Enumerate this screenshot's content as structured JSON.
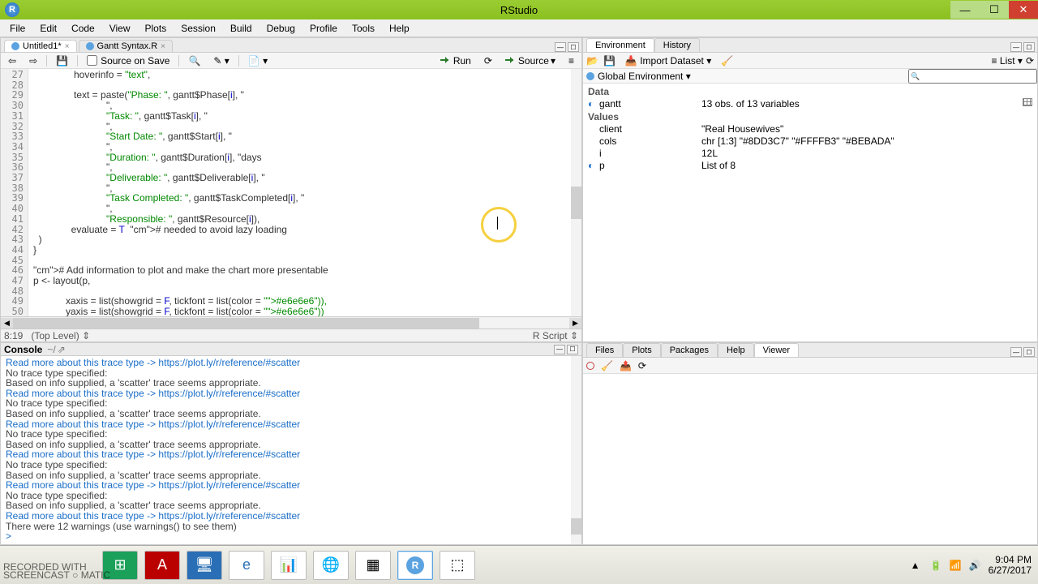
{
  "window": {
    "title": "RStudio"
  },
  "menu": [
    "File",
    "Edit",
    "Code",
    "View",
    "Plots",
    "Session",
    "Build",
    "Debug",
    "Profile",
    "Tools",
    "Help"
  ],
  "editor": {
    "tabs": [
      {
        "label": "Untitled1*",
        "active": true
      },
      {
        "label": "Gantt Syntax.R",
        "active": false
      }
    ],
    "source_on_save": "Source on Save",
    "run": "Run",
    "source": "Source",
    "first_line": 27,
    "lines": [
      "               hoverinfo = \"text\",",
      "",
      "               text = paste(\"Phase: \", gantt$Phase[i], \"",
      "                           \",",
      "                           \"Task: \", gantt$Task[i], \"",
      "                           \",",
      "                           \"Start Date: \", gantt$Start[i], \"",
      "                           \",",
      "                           \"Duration: \", gantt$Duration[i], \"days",
      "                           \",",
      "                           \"Deliverable: \", gantt$Deliverable[i], \"",
      "                           \",",
      "                           \"Task Completed: \", gantt$TaskCompleted[i], \"",
      "                           \",",
      "                           \"Responsible: \", gantt$Resource[i]),",
      "              evaluate = T  # needed to avoid lazy loading",
      "  )",
      "}",
      "",
      "# Add information to plot and make the chart more presentable",
      "p <- layout(p,",
      "",
      "            xaxis = list(showgrid = F, tickfont = list(color = \"#e6e6e6\")),",
      "            yaxis = list(showgrid = F, tickfont = list(color = \"#e6e6e6\"))",
      ""
    ],
    "cursor_pos": "8:19",
    "top_level": "(Top Level)",
    "rscript": "R Script"
  },
  "console": {
    "title": "Console",
    "path": "~/",
    "lines": [
      {
        "t": "link",
        "text": " Read more about this trace type -> https://plot.ly/r/reference/#scatter"
      },
      {
        "t": "msg",
        "text": "No trace type specified:"
      },
      {
        "t": "msg",
        "text": " Based on info supplied, a 'scatter' trace seems appropriate."
      },
      {
        "t": "link",
        "text": " Read more about this trace type -> https://plot.ly/r/reference/#scatter"
      },
      {
        "t": "msg",
        "text": "No trace type specified:"
      },
      {
        "t": "msg",
        "text": " Based on info supplied, a 'scatter' trace seems appropriate."
      },
      {
        "t": "link",
        "text": " Read more about this trace type -> https://plot.ly/r/reference/#scatter"
      },
      {
        "t": "msg",
        "text": "No trace type specified:"
      },
      {
        "t": "msg",
        "text": " Based on info supplied, a 'scatter' trace seems appropriate."
      },
      {
        "t": "link",
        "text": " Read more about this trace type -> https://plot.ly/r/reference/#scatter"
      },
      {
        "t": "msg",
        "text": "No trace type specified:"
      },
      {
        "t": "msg",
        "text": " Based on info supplied, a 'scatter' trace seems appropriate."
      },
      {
        "t": "link",
        "text": " Read more about this trace type -> https://plot.ly/r/reference/#scatter"
      },
      {
        "t": "msg",
        "text": "No trace type specified:"
      },
      {
        "t": "msg",
        "text": " Based on info supplied, a 'scatter' trace seems appropriate."
      },
      {
        "t": "link",
        "text": " Read more about this trace type -> https://plot.ly/r/reference/#scatter"
      },
      {
        "t": "warn",
        "text": "There were 12 warnings (use warnings() to see them)"
      },
      {
        "t": "prompt",
        "text": "> "
      }
    ]
  },
  "env": {
    "tabs": [
      "Environment",
      "History"
    ],
    "import": "Import Dataset",
    "list": "List",
    "scope": "Global Environment",
    "data_header": "Data",
    "values_header": "Values",
    "rows": {
      "data": [
        {
          "exp": true,
          "name": "gantt",
          "val": "13 obs. of 13 variables",
          "grid": true
        }
      ],
      "values": [
        {
          "name": "client",
          "val": "\"Real Housewives\""
        },
        {
          "name": "cols",
          "val": "chr [1:3] \"#8DD3C7\" \"#FFFFB3\" \"#BEBADA\""
        },
        {
          "name": "i",
          "val": "12L"
        },
        {
          "exp": true,
          "name": "p",
          "val": "List of 8"
        }
      ]
    }
  },
  "bottomright": {
    "tabs": [
      "Files",
      "Plots",
      "Packages",
      "Help",
      "Viewer"
    ],
    "active": "Viewer"
  },
  "taskbar": {
    "time": "9:04 PM",
    "date": "6/27/2017",
    "watermark_l1": "RECORDED WITH",
    "watermark_l2": "SCREENCAST ○ MATIC"
  }
}
